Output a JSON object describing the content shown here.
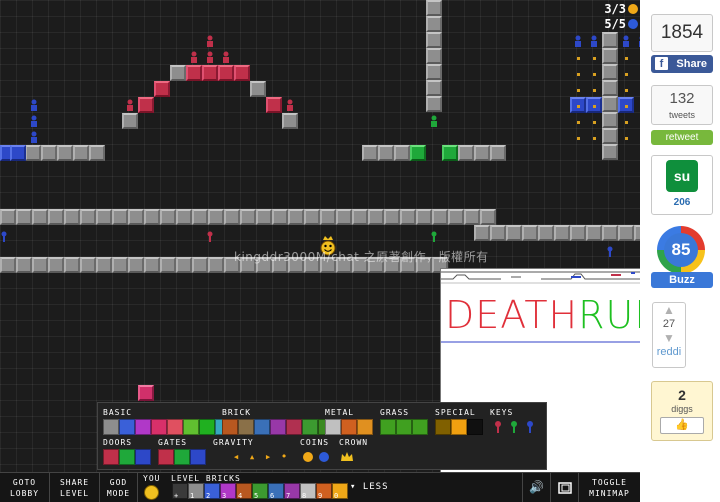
{
  "hud": {
    "coins_counter": "3/3",
    "blue_coins_counter": "5/5",
    "coin_color": "#f0a818",
    "blue_coin_color": "#2d5ad8"
  },
  "watermark_text": "kingddr3000M/chat 之原著創作，版權所有",
  "minimap": {
    "death_text": "DEATH",
    "run_text": "RUN"
  },
  "palette": {
    "basic_label": "BASIC",
    "brick_label": "BRICK",
    "metal_label": "METAL",
    "grass_label": "GRASS",
    "special_label": "SPECIAL",
    "keys_label": "KEYS",
    "doors_label": "DOORS",
    "gates_label": "GATES",
    "gravity_label": "GRAVITY",
    "coins_label": "COINS",
    "crown_label": "CROWN"
  },
  "bottom_bar": {
    "goto_lobby_label": "GOTO\nLOBBY",
    "share_level_label": "SHARE\nLEVEL",
    "god_mode_label": "GOD\nMODE",
    "you_label": "YOU",
    "level_bricks_label": "LEVEL BRICKS",
    "less_label": "LESS",
    "toggle_minimap_label": "TOGGLE\nMINIMAP",
    "slot_numbers": [
      "+",
      "1",
      "2",
      "3",
      "4",
      "5",
      "6",
      "7",
      "8",
      "9",
      "0"
    ]
  },
  "social": {
    "facebook_count": "1854",
    "facebook_button": "Share",
    "tweets_count": "132",
    "tweets_label": "tweets",
    "retweet_button": "retweet",
    "stumble_count": "206",
    "buzz_count": "85",
    "buzz_button": "Buzz",
    "reddit_count": "27",
    "reddit_label": "reddi",
    "digg_count": "2",
    "digg_label": "diggs"
  },
  "colors": {
    "background": "#1c1c1c",
    "block_gray": "#8e8e8e",
    "block_red": "#c0304a",
    "block_blue": "#2d48c8",
    "block_green": "#1fa83a",
    "facebook_blue": "#3b5998",
    "retweet_green": "#78b83c",
    "buzz_blue": "#3a78d8"
  }
}
